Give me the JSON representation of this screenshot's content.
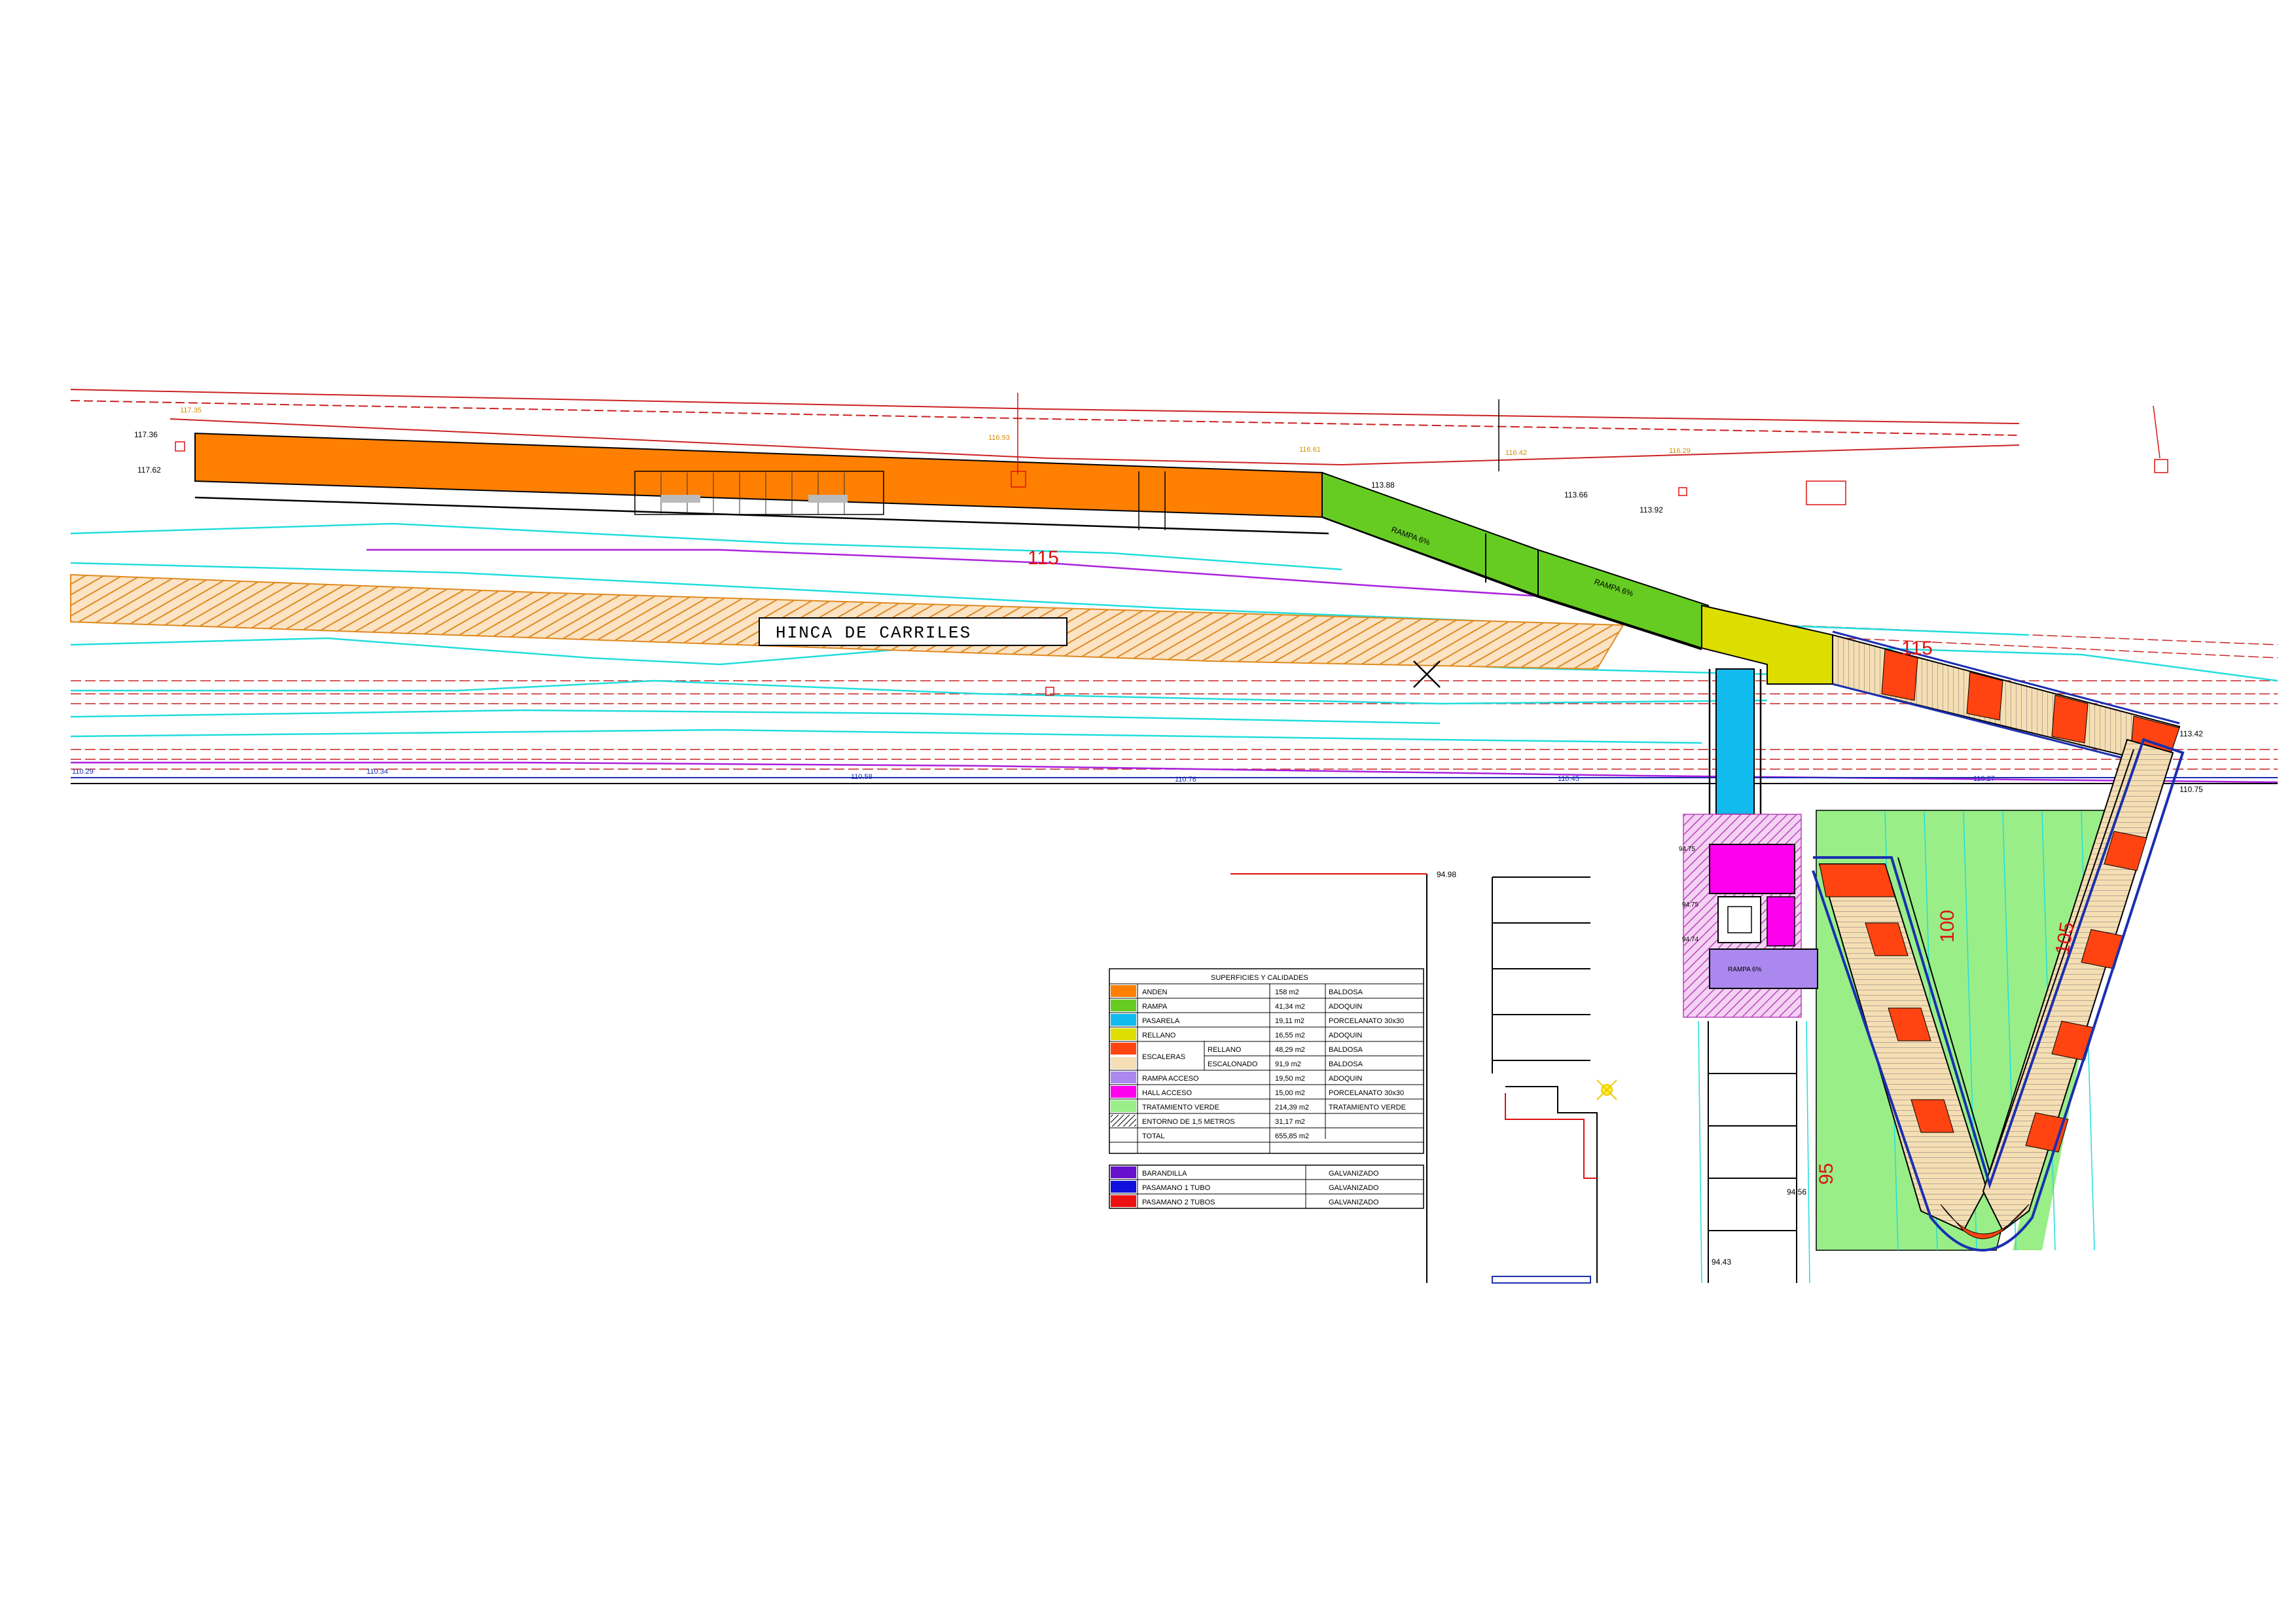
{
  "colors": {
    "anden": "#ff8000",
    "rampa": "#66cc22",
    "pasarela": "#11bbee",
    "rellano": "#dddd00",
    "escaleras_rellano": "#ff4411",
    "escalonado": "#f5deb3",
    "rampa_acceso": "#aa88ee",
    "hall_acceso": "#ff00ee",
    "tratamiento_verde": "#99ee88",
    "entorno": "#cc66cc",
    "barandilla": "#6611cc",
    "pasamano_1": "#1111dd",
    "pasamano_2": "#ee1111",
    "contour_cyan": "#22dddd",
    "contour_magenta": "#aa22dd",
    "rail_red": "#cc2222"
  },
  "labels": {
    "hinca": "HINCA        DE        CARRILES",
    "rampa_1": "RAMPA 6%",
    "rampa_2": "RAMPA 6%",
    "rampa_acceso": "RAMPA 6%",
    "contour_115a": "115",
    "contour_115b": "115",
    "contour_100": "100",
    "contour_105": "105",
    "contour_95": "95"
  },
  "elevations": {
    "e1": "117.36",
    "e2": "117.62",
    "e3": "113.66",
    "e4": "113.92",
    "e5": "113.88",
    "e6": "110.29",
    "e7": "110.34",
    "e8": "110.58",
    "e9": "110.76",
    "e10": "110.45",
    "e11": "110.27",
    "e12": "110.75",
    "e13": "113.42",
    "e14": "94.98",
    "e15": "94.75",
    "e16": "94.75",
    "e17": "94.74",
    "e18": "94.56",
    "e19": "94.43",
    "top1": "117.35",
    "top2": "116.93",
    "top3": "116.61",
    "top4": "116.42",
    "top5": "116.29"
  },
  "table": {
    "title": "SUPERFICIES Y CALIDADES",
    "rows": [
      {
        "name": "ANDEN",
        "sub": "",
        "area": "158 m2",
        "material": "BALDOSA"
      },
      {
        "name": "RAMPA",
        "sub": "",
        "area": "41,34 m2",
        "material": "ADOQUIN"
      },
      {
        "name": "PASARELA",
        "sub": "",
        "area": "19,11 m2",
        "material": "PORCELANATO 30x30"
      },
      {
        "name": "RELLANO",
        "sub": "",
        "area": "16,55 m2",
        "material": "ADOQUIN"
      },
      {
        "name": "ESCALERAS",
        "sub": "RELLANO",
        "area": "48,29 m2",
        "material": "BALDOSA"
      },
      {
        "name": "",
        "sub": "ESCALONADO",
        "area": "91,9 m2",
        "material": "BALDOSA"
      },
      {
        "name": "RAMPA ACCESO",
        "sub": "",
        "area": "19,50 m2",
        "material": "ADOQUIN"
      },
      {
        "name": "HALL ACCESO",
        "sub": "",
        "area": "15,00 m2",
        "material": "PORCELANATO 30x30"
      },
      {
        "name": "TRATAMIENTO VERDE",
        "sub": "",
        "area": "214,39 m2",
        "material": "TRATAMIENTO VERDE"
      },
      {
        "name": "ENTORNO DE 1,5 METROS",
        "sub": "",
        "area": "31,17 m2",
        "material": ""
      },
      {
        "name": "TOTAL",
        "sub": "",
        "area": "655,85 m2",
        "material": ""
      }
    ],
    "rails": [
      {
        "name": "BARANDILLA",
        "material": "GALVANIZADO"
      },
      {
        "name": "PASAMANO 1 TUBO",
        "material": "GALVANIZADO"
      },
      {
        "name": "PASAMANO 2 TUBOS",
        "material": "GALVANIZADO"
      }
    ]
  }
}
